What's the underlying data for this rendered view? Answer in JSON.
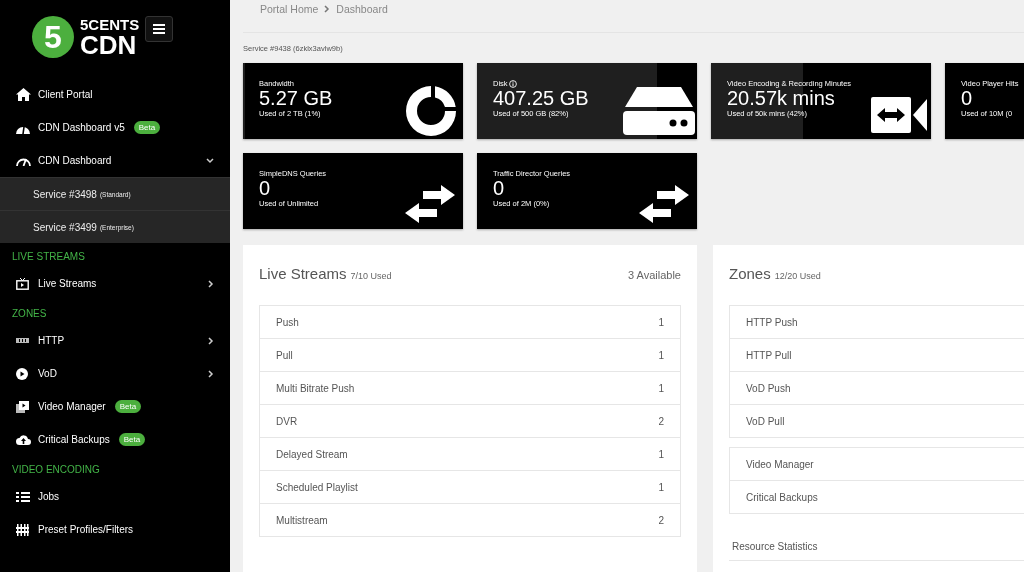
{
  "sidebar": {
    "logo": {
      "mark": "5",
      "line1": "5CENTS",
      "line2": "CDN"
    },
    "items": [
      {
        "kind": "link",
        "label": "Client Portal"
      },
      {
        "kind": "link",
        "label": "CDN Dashboard v5",
        "badge": "Beta"
      },
      {
        "kind": "link",
        "label": "CDN Dashboard",
        "expanded": true,
        "children": [
          {
            "label": "Service #3498",
            "note": "(Standard)"
          },
          {
            "label": "Service #3499",
            "note": "(Enterprise)"
          }
        ]
      },
      {
        "kind": "section",
        "label": "LIVE STREAMS"
      },
      {
        "kind": "link",
        "label": "Live Streams",
        "expanded": false
      },
      {
        "kind": "section",
        "label": "ZONES"
      },
      {
        "kind": "link",
        "label": "HTTP",
        "expanded": false
      },
      {
        "kind": "link",
        "label": "VoD",
        "expanded": false
      },
      {
        "kind": "link",
        "label": "Video Manager",
        "badge": "Beta"
      },
      {
        "kind": "link",
        "label": "Critical Backups",
        "badge": "Beta"
      },
      {
        "kind": "section",
        "label": "VIDEO ENCODING"
      },
      {
        "kind": "link",
        "label": "Jobs"
      },
      {
        "kind": "link",
        "label": "Preset Profiles/Filters"
      }
    ]
  },
  "breadcrumb": [
    "Portal Home",
    "Dashboard"
  ],
  "service": "Service #9438 (6zklx3avlw9b)",
  "stats": [
    {
      "title": "Bandwidth",
      "value": "5.27 GB",
      "sub": "Used of 2 TB (1%)",
      "level": 0.01
    },
    {
      "title": "Disk",
      "info_icon": true,
      "value": "407.25 GB",
      "sub": "Used of 500 GB (82%)",
      "level": 0.82
    },
    {
      "title": "Video Encoding & Recording Minutes",
      "value": "20.57k mins",
      "sub": "Used of 50k mins (42%)",
      "level": 0.42
    },
    {
      "title": "Video Player Hits",
      "value": "0",
      "sub": "Used of 10M (0"
    },
    {
      "title": "SimpleDNS Queries",
      "value": "0",
      "sub": "Used of Unlimited"
    },
    {
      "title": "Traffic Director Queries",
      "value": "0",
      "sub": "Used of 2M (0%)"
    }
  ],
  "live_streams": {
    "title": "Live Streams",
    "used": "7/10 Used",
    "available": "3 Available",
    "rows": [
      {
        "label": "Push",
        "count": "1"
      },
      {
        "label": "Pull",
        "count": "1"
      },
      {
        "label": "Multi Bitrate Push",
        "count": "1"
      },
      {
        "label": "DVR",
        "count": "2"
      },
      {
        "label": "Delayed Stream",
        "count": "1"
      },
      {
        "label": "Scheduled Playlist",
        "count": "1"
      },
      {
        "label": "Multistream",
        "count": "2"
      }
    ]
  },
  "zones": {
    "title": "Zones",
    "used": "12/20 Used",
    "groups": [
      [
        "HTTP Push",
        "HTTP Pull",
        "VoD Push",
        "VoD Pull"
      ],
      [
        "Video Manager",
        "Critical Backups"
      ]
    ],
    "footer": "Resource Statistics"
  }
}
